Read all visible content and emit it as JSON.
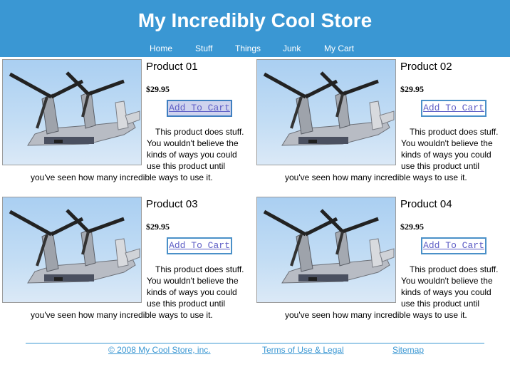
{
  "site": {
    "title": "My Incredibly Cool Store"
  },
  "nav": [
    "Home",
    "Stuff",
    "Things",
    "Junk",
    "My Cart"
  ],
  "products": [
    {
      "name": "Product 01",
      "price": "$29.95",
      "button": "Add To Cart",
      "image": "tiltrotor-aircraft-photo",
      "desc_lines": [
        "This product does stuff.",
        "You wouldn't believe the",
        "kinds of ways you could",
        "use this product until",
        "you've seen how many incredible ways to use it."
      ]
    },
    {
      "name": "Product 02",
      "price": "$29.95",
      "button": "Add To Cart",
      "image": "tiltrotor-aircraft-photo",
      "desc_lines": [
        "This product does stuff.",
        "You wouldn't believe the",
        "kinds of ways you could",
        "use this product until",
        "you've seen how many incredible ways to use it."
      ]
    },
    {
      "name": "Product 03",
      "price": "$29.95",
      "button": "Add To Cart",
      "image": "tiltrotor-aircraft-photo",
      "desc_lines": [
        "This product does stuff.",
        "You wouldn't believe the",
        "kinds of ways you could",
        "use this product until",
        "you've seen how many incredible ways to use it."
      ]
    },
    {
      "name": "Product 04",
      "price": "$29.95",
      "button": "Add To Cart",
      "image": "tiltrotor-aircraft-photo",
      "desc_lines": [
        "This product does stuff.",
        "You wouldn't believe the",
        "kinds of ways you could",
        "use this product until",
        "you've seen how many incredible ways to use it."
      ]
    }
  ],
  "footer": {
    "copyright": "© 2008 My Cool Store, inc.",
    "terms": "Terms of Use & Legal",
    "sitemap": "Sitemap"
  },
  "colors": {
    "header": "#3a97d3",
    "link": "#3a97d3",
    "button_text": "#5f5fc6"
  }
}
